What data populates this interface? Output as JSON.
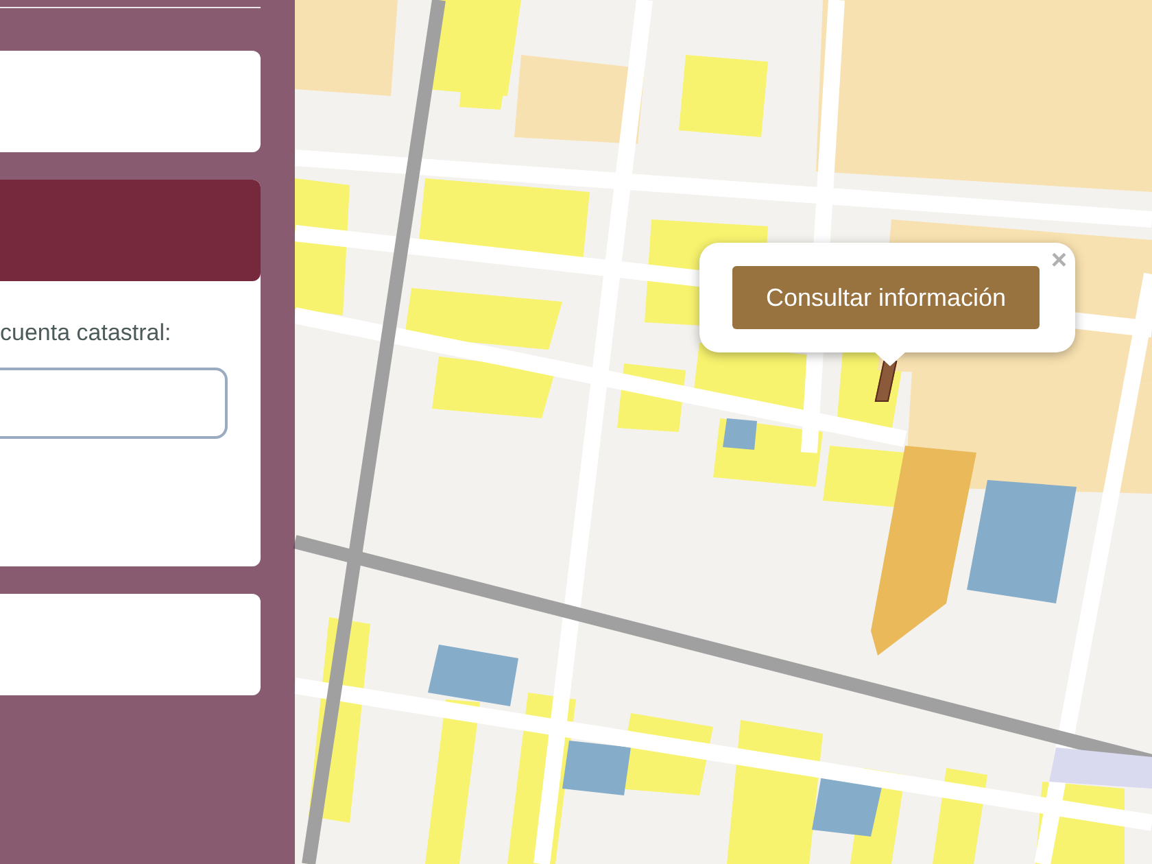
{
  "sidebar": {
    "search_form": {
      "label": "cuenta catastral:"
    }
  },
  "map": {
    "popup": {
      "button": "Consultar información",
      "close": "×"
    }
  }
}
